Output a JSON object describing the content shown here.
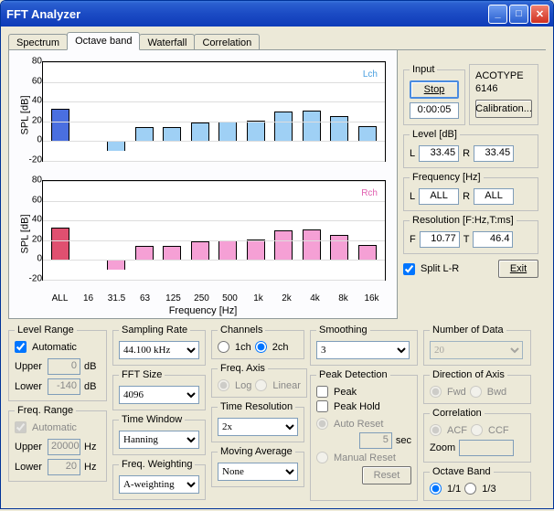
{
  "window": {
    "title": "FFT Analyzer"
  },
  "tabs": [
    "Spectrum",
    "Octave band",
    "Waterfall",
    "Correlation"
  ],
  "active_tab": 1,
  "chart_data": [
    {
      "type": "bar",
      "label": "Lch",
      "color_fill": "#9fd0f5",
      "color_first": "#4a6fe0",
      "ylabel": "SPL [dB]",
      "ylim": [
        -20,
        80
      ],
      "yticks": [
        "-20",
        "0",
        "20",
        "40",
        "60",
        "80"
      ],
      "categories": [
        "ALL",
        "16",
        "31.5",
        "63",
        "125",
        "250",
        "500",
        "1k",
        "2k",
        "4k",
        "8k",
        "16k"
      ],
      "values": [
        33,
        null,
        -10,
        14,
        14,
        19,
        20,
        21,
        30,
        31,
        25,
        15
      ]
    },
    {
      "type": "bar",
      "label": "Rch",
      "color_fill": "#f5a0d5",
      "color_first": "#e05070",
      "ylabel": "SPL [dB]",
      "ylim": [
        -20,
        80
      ],
      "yticks": [
        "-20",
        "0",
        "20",
        "40",
        "60",
        "80"
      ],
      "categories": [
        "ALL",
        "16",
        "31.5",
        "63",
        "125",
        "250",
        "500",
        "1k",
        "2k",
        "4k",
        "8k",
        "16k"
      ],
      "values": [
        33,
        null,
        -10,
        14,
        14,
        19,
        20,
        21,
        30,
        31,
        25,
        15
      ]
    }
  ],
  "xlabel": "Frequency [Hz]",
  "input": {
    "legend": "Input",
    "button": "Stop",
    "time": "0:00:05"
  },
  "device": {
    "type": "ACOTYPE",
    "model": "6146",
    "calibration": "Calibration..."
  },
  "level": {
    "legend": "Level [dB]",
    "L": "33.45",
    "R": "33.45"
  },
  "freq": {
    "legend": "Frequency [Hz]",
    "L": "ALL",
    "R": "ALL"
  },
  "resolution": {
    "legend": "Resolution [F:Hz,T:ms]",
    "F": "10.77",
    "T": "46.4"
  },
  "split_label": "Split L-R",
  "exit": "Exit",
  "level_range": {
    "legend": "Level Range",
    "auto": "Automatic",
    "upper_lbl": "Upper",
    "upper": "0",
    "lower_lbl": "Lower",
    "lower": "-140",
    "unit": "dB"
  },
  "freq_range": {
    "legend": "Freq. Range",
    "auto": "Automatic",
    "upper_lbl": "Upper",
    "upper": "20000",
    "lower_lbl": "Lower",
    "lower": "20",
    "unit": "Hz"
  },
  "sampling": {
    "legend": "Sampling Rate",
    "value": "44.100 kHz"
  },
  "fft": {
    "legend": "FFT Size",
    "value": "4096"
  },
  "window_fn": {
    "legend": "Time Window",
    "value": "Hanning"
  },
  "weighting": {
    "legend": "Freq. Weighting",
    "value": "A-weighting"
  },
  "channels": {
    "legend": "Channels",
    "ch1": "1ch",
    "ch2": "2ch"
  },
  "freq_axis": {
    "legend": "Freq. Axis",
    "log": "Log",
    "linear": "Linear"
  },
  "time_res": {
    "legend": "Time Resolution",
    "value": "2x"
  },
  "mavg": {
    "legend": "Moving Average",
    "value": "None"
  },
  "smoothing": {
    "legend": "Smoothing",
    "value": "3"
  },
  "peak": {
    "legend": "Peak Detection",
    "peak": "Peak",
    "hold": "Peak Hold",
    "auto": "Auto Reset",
    "sec_val": "5",
    "sec": "sec",
    "manual": "Manual Reset",
    "reset": "Reset"
  },
  "numdata": {
    "legend": "Number of Data",
    "value": "20"
  },
  "diraxis": {
    "legend": "Direction of Axis",
    "fwd": "Fwd",
    "bwd": "Bwd"
  },
  "corr": {
    "legend": "Correlation",
    "acf": "ACF",
    "ccf": "CCF",
    "zoom": "Zoom"
  },
  "octave": {
    "legend": "Octave Band",
    "a": "1/1",
    "b": "1/3"
  }
}
